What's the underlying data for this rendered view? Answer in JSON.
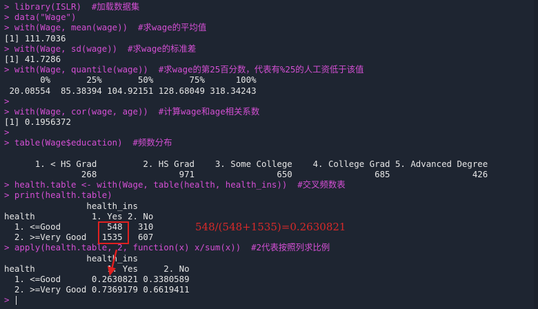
{
  "prompt_symbol": ">",
  "lines": [
    {
      "kind": "cmd",
      "text": "library(ISLR)  #加载数据集"
    },
    {
      "kind": "cmd",
      "text": "data(\"Wage\")"
    },
    {
      "kind": "cmd",
      "text": "with(Wage, mean(wage))  #求wage的平均值"
    },
    {
      "kind": "out",
      "text": "[1] 111.7036"
    },
    {
      "kind": "cmd",
      "text": "with(Wage, sd(wage))  #求wage的标准差"
    },
    {
      "kind": "out",
      "text": "[1] 41.7286"
    },
    {
      "kind": "cmd",
      "text": "with(Wage, quantile(wage))  #求wage的第25百分数，代表有%25的人工资低于该值"
    },
    {
      "kind": "out",
      "text": "       0%       25%       50%       75%      100% "
    },
    {
      "kind": "out",
      "text": " 20.08554  85.38394 104.92151 128.68049 318.34243 "
    },
    {
      "kind": "cmd",
      "text": ""
    },
    {
      "kind": "cmd",
      "text": "with(Wage, cor(wage, age))  #计算wage和age相关系数"
    },
    {
      "kind": "out",
      "text": "[1] 0.1956372"
    },
    {
      "kind": "cmd",
      "text": ""
    },
    {
      "kind": "cmd",
      "text": "table(Wage$education)  #频数分布"
    },
    {
      "kind": "out",
      "text": ""
    },
    {
      "kind": "out",
      "text": "      1. < HS Grad         2. HS Grad    3. Some College    4. College Grad 5. Advanced Degree "
    },
    {
      "kind": "out",
      "text": "               268                971                650                685                426 "
    },
    {
      "kind": "cmd",
      "text": "health.table <- with(Wage, table(health, health_ins))  #交叉频数表"
    },
    {
      "kind": "cmd",
      "text": "print(health.table)"
    },
    {
      "kind": "out",
      "text": "                health_ins"
    },
    {
      "kind": "out",
      "text": "health           1. Yes 2. No"
    },
    {
      "kind": "out",
      "text": "  1. <=Good         548   310"
    },
    {
      "kind": "out",
      "text": "  2. >=Very Good   1535   607"
    },
    {
      "kind": "cmd",
      "text": "apply(health.table, 2, function(x) x/sum(x))  #2代表按照列求比例"
    },
    {
      "kind": "out",
      "text": "                health_ins"
    },
    {
      "kind": "out",
      "text": "health              1. Yes     2. No"
    },
    {
      "kind": "out",
      "text": "  1. <=Good      0.2630821 0.3380589"
    },
    {
      "kind": "out",
      "text": "  2. >=Very Good 0.7369179 0.6619411"
    },
    {
      "kind": "cursor",
      "text": ""
    }
  ],
  "annotation": "548/(548+1535)=0.2630821",
  "colors": {
    "background": "#1e2531",
    "command": "#d34fd3",
    "output": "#e6e6e6",
    "highlight": "#e02020"
  }
}
